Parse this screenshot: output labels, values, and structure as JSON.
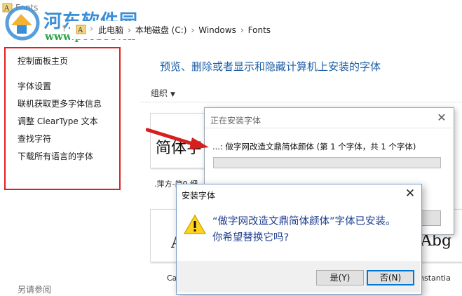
{
  "window": {
    "title": "Fonts"
  },
  "watermark": {
    "name": "河东软件园",
    "url": "www.pc0359.cn"
  },
  "addressbar": {
    "back_icon": "back-arrow-icon",
    "up_icon": "up-arrow-icon",
    "breadcrumbs": [
      "此电脑",
      "本地磁盘 (C:)",
      "Windows",
      "Fonts"
    ],
    "separator": "›"
  },
  "sidebar": {
    "items": [
      {
        "label": "控制面板主页"
      },
      {
        "label": "字体设置"
      },
      {
        "label": "联机获取更多字体信息"
      },
      {
        "label": "调整 ClearType 文本"
      },
      {
        "label": "查找字符"
      },
      {
        "label": "下载所有语言的字体"
      }
    ],
    "see_also": "另请参阅",
    "highlight_color": "#e0201f"
  },
  "main": {
    "heading": "预览、删除或者显示和隐藏计算机上安装的字体",
    "organize_label": "组织",
    "tiles": [
      {
        "preview": "简体字",
        "caption": ".萍方-简0 细"
      },
      {
        "preview": "A",
        "caption": "Ca"
      },
      {
        "preview": "Abg",
        "caption": "nstantia"
      }
    ]
  },
  "progress_dialog": {
    "title": "正在安装字体",
    "close": "✕",
    "status_text": "...: 做字网改造文鼎简体颜体 (第 1 个字体，共 1 个字体)",
    "progress": 0
  },
  "confirm_dialog": {
    "title": "安装字体",
    "close": "✕",
    "message_line1": "“做字网改造文鼎简体颜体”字体已安装。",
    "message_line2": "你希望替换它吗?",
    "yes_label": "是(Y)",
    "no_label": "否(N)",
    "icon": "warning-icon"
  }
}
